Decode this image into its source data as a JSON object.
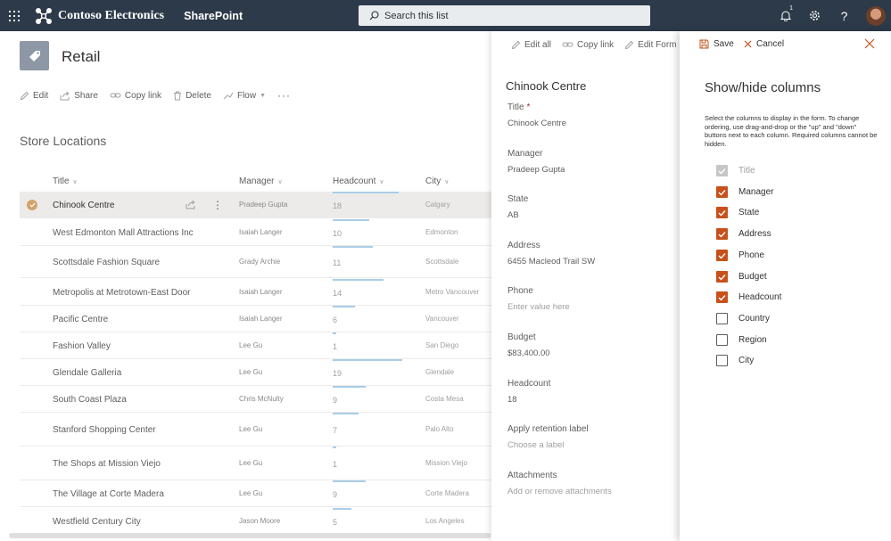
{
  "suitebar": {
    "org_name": "Contoso Electronics",
    "app_name": "SharePoint",
    "search_placeholder": "Search this list",
    "notification_count": "1",
    "help_label": "?"
  },
  "site": {
    "title": "Retail"
  },
  "commands": {
    "edit": "Edit",
    "share": "Share",
    "copy_link": "Copy link",
    "delete": "Delete",
    "flow": "Flow",
    "more": "···"
  },
  "list": {
    "title": "Store Locations",
    "columns": {
      "title": "Title",
      "manager": "Manager",
      "headcount": "Headcount",
      "city": "City"
    },
    "headcount_max": 20,
    "rows": [
      {
        "title": "Chinook Centre",
        "manager": "Pradeep Gupta",
        "headcount": 18,
        "city": "Calgary",
        "selected": true
      },
      {
        "title": "West Edmonton Mall Attractions Inc",
        "manager": "Isaiah Langer",
        "headcount": 10,
        "city": "Edmonton"
      },
      {
        "title": "Scottsdale Fashion Square",
        "manager": "Grady Archie",
        "headcount": 11,
        "city": "Scottsdale"
      },
      {
        "title": "Metropolis at Metrotown-East Door",
        "manager": "Isaiah Langer",
        "headcount": 14,
        "city": "Metro Vancouver"
      },
      {
        "title": "Pacific Centre",
        "manager": "Isaiah Langer",
        "headcount": 6,
        "city": "Vancouver"
      },
      {
        "title": "Fashion Valley",
        "manager": "Lee Gu",
        "headcount": 1,
        "city": "San Diego"
      },
      {
        "title": "Glendale Galleria",
        "manager": "Lee Gu",
        "headcount": 19,
        "city": "Glendale"
      },
      {
        "title": "South Coast Plaza",
        "manager": "Chris McNulty",
        "headcount": 9,
        "city": "Costa Mesa"
      },
      {
        "title": "Stanford Shopping Center",
        "manager": "Lee Gu",
        "headcount": 7,
        "city": "Palo Alto"
      },
      {
        "title": "The Shops at Mission Viejo",
        "manager": "Lee Gu",
        "headcount": 1,
        "city": "Mission Viejo"
      },
      {
        "title": "The Village at Corte Madera",
        "manager": "Lee Gu",
        "headcount": 9,
        "city": "Corte Madera"
      },
      {
        "title": "Westfield Century City",
        "manager": "Jason Moore",
        "headcount": 5,
        "city": "Los Angeles"
      }
    ]
  },
  "form": {
    "commands": {
      "edit_all": "Edit all",
      "copy_link": "Copy link",
      "edit_form": "Edit Form"
    },
    "item_title": "Chinook Centre",
    "fields": [
      {
        "label": "Title",
        "required": "*",
        "value": "Chinook Centre",
        "placeholder": false
      },
      {
        "label": "Manager",
        "required": "",
        "value": "Pradeep Gupta",
        "placeholder": false
      },
      {
        "label": "State",
        "required": "",
        "value": "AB",
        "placeholder": false
      },
      {
        "label": "Address",
        "required": "",
        "value": "6455 Macleod Trail SW",
        "placeholder": false
      },
      {
        "label": "Phone",
        "required": "",
        "value": "Enter value here",
        "placeholder": true
      },
      {
        "label": "Budget",
        "required": "",
        "value": "$83,400.00",
        "placeholder": false
      },
      {
        "label": "Headcount",
        "required": "",
        "value": "18",
        "placeholder": false
      },
      {
        "label": "Apply retention label",
        "required": "",
        "value": "Choose a label",
        "placeholder": true
      },
      {
        "label": "Attachments",
        "required": "",
        "value": "Add or remove attachments",
        "placeholder": true
      }
    ]
  },
  "columns_panel": {
    "save_label": "Save",
    "cancel_label": "Cancel",
    "title": "Show/hide columns",
    "description": "Select the columns to display in the form. To change ordering, use drag-and-drop or the \"up\" and \"down\" buttons next to each column. Required columns cannot be hidden.",
    "accent_color": "#c7501b",
    "items": [
      {
        "label": "Title",
        "checked": true,
        "disabled": true
      },
      {
        "label": "Manager",
        "checked": true,
        "disabled": false
      },
      {
        "label": "State",
        "checked": true,
        "disabled": false
      },
      {
        "label": "Address",
        "checked": true,
        "disabled": false
      },
      {
        "label": "Phone",
        "checked": true,
        "disabled": false
      },
      {
        "label": "Budget",
        "checked": true,
        "disabled": false
      },
      {
        "label": "Headcount",
        "checked": true,
        "disabled": false
      },
      {
        "label": "Country",
        "checked": false,
        "disabled": false
      },
      {
        "label": "Region",
        "checked": false,
        "disabled": false
      },
      {
        "label": "City",
        "checked": false,
        "disabled": false
      }
    ]
  }
}
